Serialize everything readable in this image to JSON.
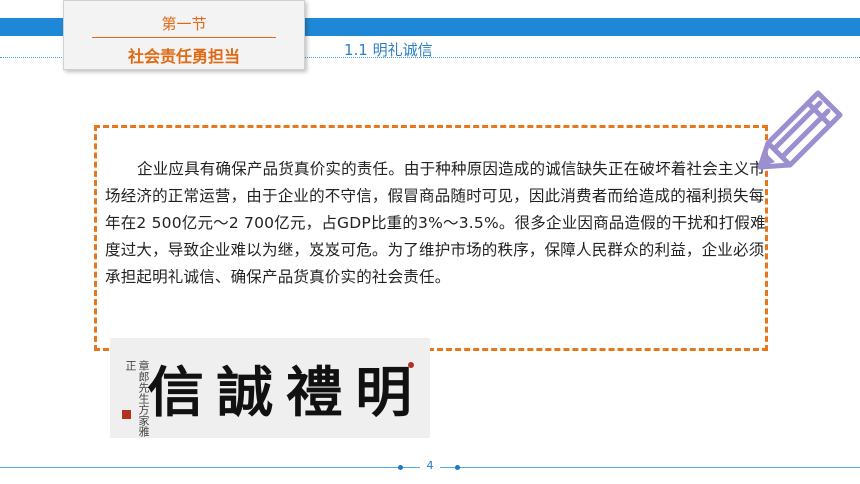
{
  "header": {
    "section_number": "第一节",
    "section_title": "社会责任勇担当",
    "subsection": "1.1  明礼诚信"
  },
  "content": {
    "paragraph": "企业应具有确保产品货真价实的责任。由于种种原因造成的诚信缺失正在破坏着社会主义市场经济的正常运营，由于企业的不守信，假冒商品随时可见，因此消费者而给造成的福利损失每年在2 500亿元～2 700亿元，占GDP比重的3%～3.5%。很多企业因商品造假的干扰和打假难度过大，导致企业难以为继，岌岌可危。为了维护市场的秩序，保障人民群众的利益，企业必须承担起明礼诚信、确保产品货真价实的社会责任。"
  },
  "calligraphy": {
    "characters": "信誠禮明",
    "inscription": "章郎先生方家雅正"
  },
  "footer": {
    "page_number": "4"
  },
  "colors": {
    "accent_blue": "#1e88d6",
    "accent_orange": "#e8761b",
    "pencil_purple": "#9b8fd0"
  },
  "icons": {
    "pencil": "pencil-icon"
  }
}
